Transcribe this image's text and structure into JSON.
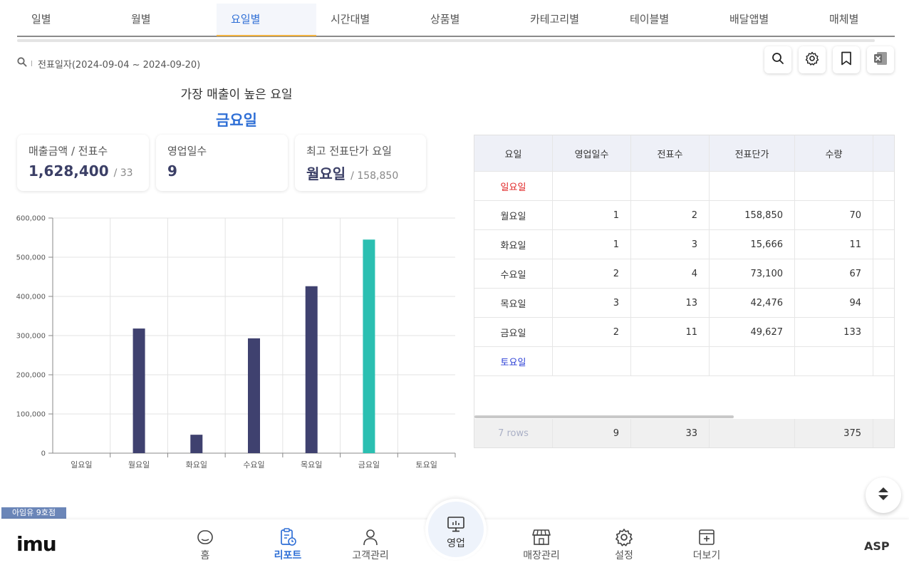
{
  "tabs": [
    "일별",
    "월별",
    "요일별",
    "시간대별",
    "상품별",
    "카테고리별",
    "테이블별",
    "배달앱별",
    "매체별"
  ],
  "active_tab_index": 2,
  "filter": {
    "label": "전표일자(2024-09-04 ~ 2024-09-20)"
  },
  "toolbar": {
    "icons": [
      "search-icon",
      "gear-icon",
      "bookmark-icon",
      "excel-icon"
    ]
  },
  "headline": {
    "question": "가장 매출이 높은 요일",
    "answer": "금요일"
  },
  "cards": [
    {
      "label": "매출금액 / 전표수",
      "value": "1,628,400",
      "sub": "/ 33"
    },
    {
      "label": "영업일수",
      "value": "9",
      "sub": ""
    },
    {
      "label": "최고 전표단가 요일",
      "value": "월요일",
      "sub": "/ 158,850"
    }
  ],
  "chart_data": {
    "type": "bar",
    "categories": [
      "일요일",
      "월요일",
      "화요일",
      "수요일",
      "목요일",
      "금요일",
      "토요일"
    ],
    "values": [
      0,
      318000,
      47000,
      293000,
      426000,
      545000,
      0
    ],
    "ylim": [
      0,
      600000
    ],
    "yticks": [
      "0",
      "100,000",
      "200,000",
      "300,000",
      "400,000",
      "500,000",
      "600,000"
    ],
    "highlight_index": 5,
    "colors": {
      "bar": "#3f416f",
      "highlight": "#2bbfb1"
    },
    "grid": true,
    "title": "",
    "xlabel": "",
    "ylabel": ""
  },
  "table": {
    "headers": [
      "요일",
      "영업일수",
      "전표수",
      "전표단가",
      "수량"
    ],
    "rows": [
      {
        "day": "일요일",
        "days": "",
        "slips": "",
        "price": "",
        "qty": "",
        "color": "#e02424"
      },
      {
        "day": "월요일",
        "days": "1",
        "slips": "2",
        "price": "158,850",
        "qty": "70",
        "color": "#333333"
      },
      {
        "day": "화요일",
        "days": "1",
        "slips": "3",
        "price": "15,666",
        "qty": "11",
        "color": "#333333"
      },
      {
        "day": "수요일",
        "days": "2",
        "slips": "4",
        "price": "73,100",
        "qty": "67",
        "color": "#333333"
      },
      {
        "day": "목요일",
        "days": "3",
        "slips": "13",
        "price": "42,476",
        "qty": "94",
        "color": "#333333"
      },
      {
        "day": "금요일",
        "days": "2",
        "slips": "11",
        "price": "49,627",
        "qty": "133",
        "color": "#333333"
      },
      {
        "day": "토요일",
        "days": "",
        "slips": "",
        "price": "",
        "qty": "",
        "color": "#2b3fd6"
      }
    ],
    "footer": {
      "rows": "7 rows",
      "days": "9",
      "slips": "33",
      "price": "",
      "qty": "375"
    }
  },
  "store_badge": "아임유 9호점",
  "bottom_nav": {
    "logo": "imu",
    "items": [
      {
        "label": "홈",
        "icon": "home-icon"
      },
      {
        "label": "리포트",
        "icon": "report-icon"
      },
      {
        "label": "고객관리",
        "icon": "user-icon"
      },
      {
        "label": "영업",
        "icon": "pos-monitor-icon"
      },
      {
        "label": "매장관리",
        "icon": "store-icon"
      },
      {
        "label": "설정",
        "icon": "gear-icon"
      },
      {
        "label": "더보기",
        "icon": "more-icon"
      }
    ],
    "active_index": 1,
    "right_label": "ASP"
  }
}
